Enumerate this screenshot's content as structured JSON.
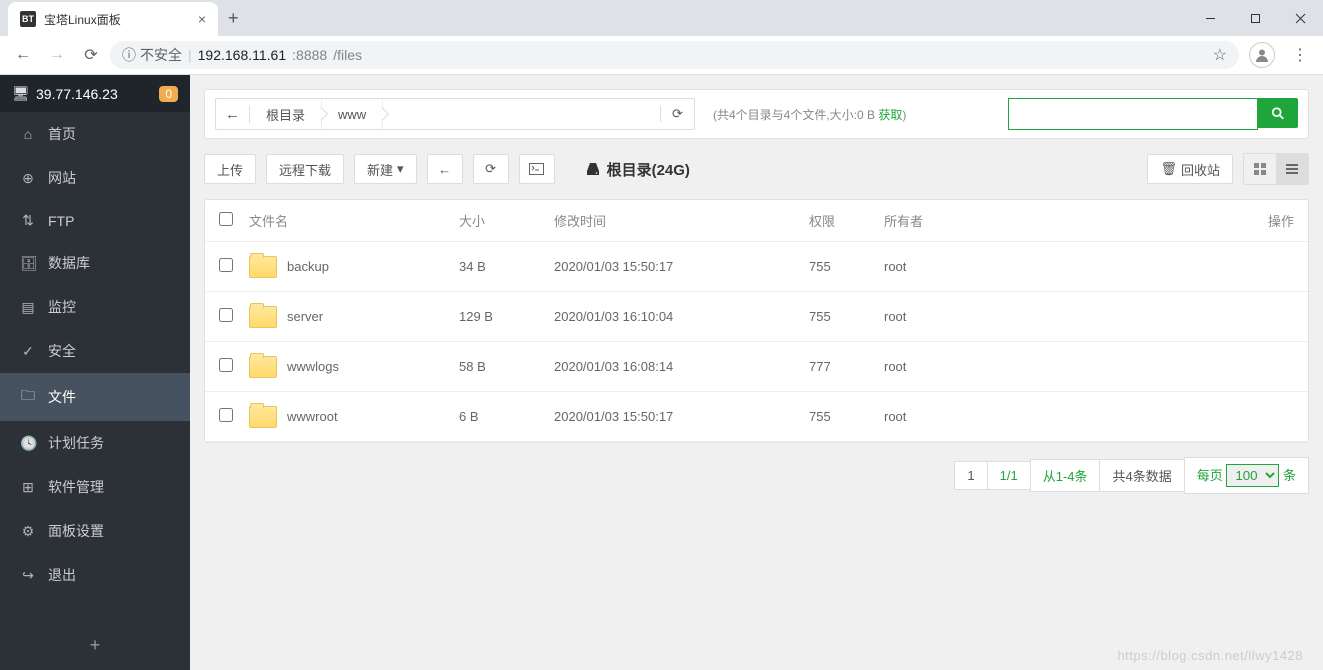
{
  "browser": {
    "tab_title": "宝塔Linux面板",
    "favicon": "BT",
    "insecure_label": "不安全",
    "url_host": "192.168.11.61",
    "url_port": ":8888",
    "url_path": "/files"
  },
  "sidebar": {
    "ip": "39.77.146.23",
    "badge": "0",
    "items": [
      {
        "icon": "home-icon",
        "glyph": "⌂",
        "label": "首页"
      },
      {
        "icon": "globe-icon",
        "glyph": "⊕",
        "label": "网站"
      },
      {
        "icon": "ftp-icon",
        "glyph": "⇅",
        "label": "FTP"
      },
      {
        "icon": "database-icon",
        "glyph": "🗄",
        "label": "数据库"
      },
      {
        "icon": "monitor-icon",
        "glyph": "▤",
        "label": "监控"
      },
      {
        "icon": "shield-icon",
        "glyph": "✓",
        "label": "安全"
      },
      {
        "icon": "folder-icon",
        "glyph": "🗀",
        "label": "文件",
        "active": true
      },
      {
        "icon": "schedule-icon",
        "glyph": "🕓",
        "label": "计划任务"
      },
      {
        "icon": "apps-icon",
        "glyph": "⊞",
        "label": "软件管理"
      },
      {
        "icon": "settings-icon",
        "glyph": "⚙",
        "label": "面板设置"
      },
      {
        "icon": "exit-icon",
        "glyph": "↪",
        "label": "退出"
      }
    ]
  },
  "path_bar": {
    "root_label": "根目录",
    "segs": [
      "www"
    ],
    "summary_prefix": "(共4个目录与4个文件,大小:0 B ",
    "summary_link": "获取",
    "summary_suffix": ")"
  },
  "toolbar": {
    "upload": "上传",
    "remote_dl": "远程下载",
    "new": "新建",
    "disk_label": "根目录(24G)",
    "recycle": "回收站"
  },
  "table": {
    "headers": {
      "name": "文件名",
      "size": "大小",
      "mtime": "修改时间",
      "perm": "权限",
      "owner": "所有者",
      "ops": "操作"
    },
    "rows": [
      {
        "name": "backup",
        "size": "34 B",
        "mtime": "2020/01/03 15:50:17",
        "perm": "755",
        "owner": "root"
      },
      {
        "name": "server",
        "size": "129 B",
        "mtime": "2020/01/03 16:10:04",
        "perm": "755",
        "owner": "root"
      },
      {
        "name": "wwwlogs",
        "size": "58 B",
        "mtime": "2020/01/03 16:08:14",
        "perm": "777",
        "owner": "root"
      },
      {
        "name": "wwwroot",
        "size": "6 B",
        "mtime": "2020/01/03 15:50:17",
        "perm": "755",
        "owner": "root"
      }
    ]
  },
  "pager": {
    "page": "1",
    "pages": "1/1",
    "range": "从1-4条",
    "total": "共4条数据",
    "per_label": "每页",
    "per_value": "100",
    "per_suffix": "条"
  },
  "watermark": "https://blog.csdn.net/llwy1428"
}
